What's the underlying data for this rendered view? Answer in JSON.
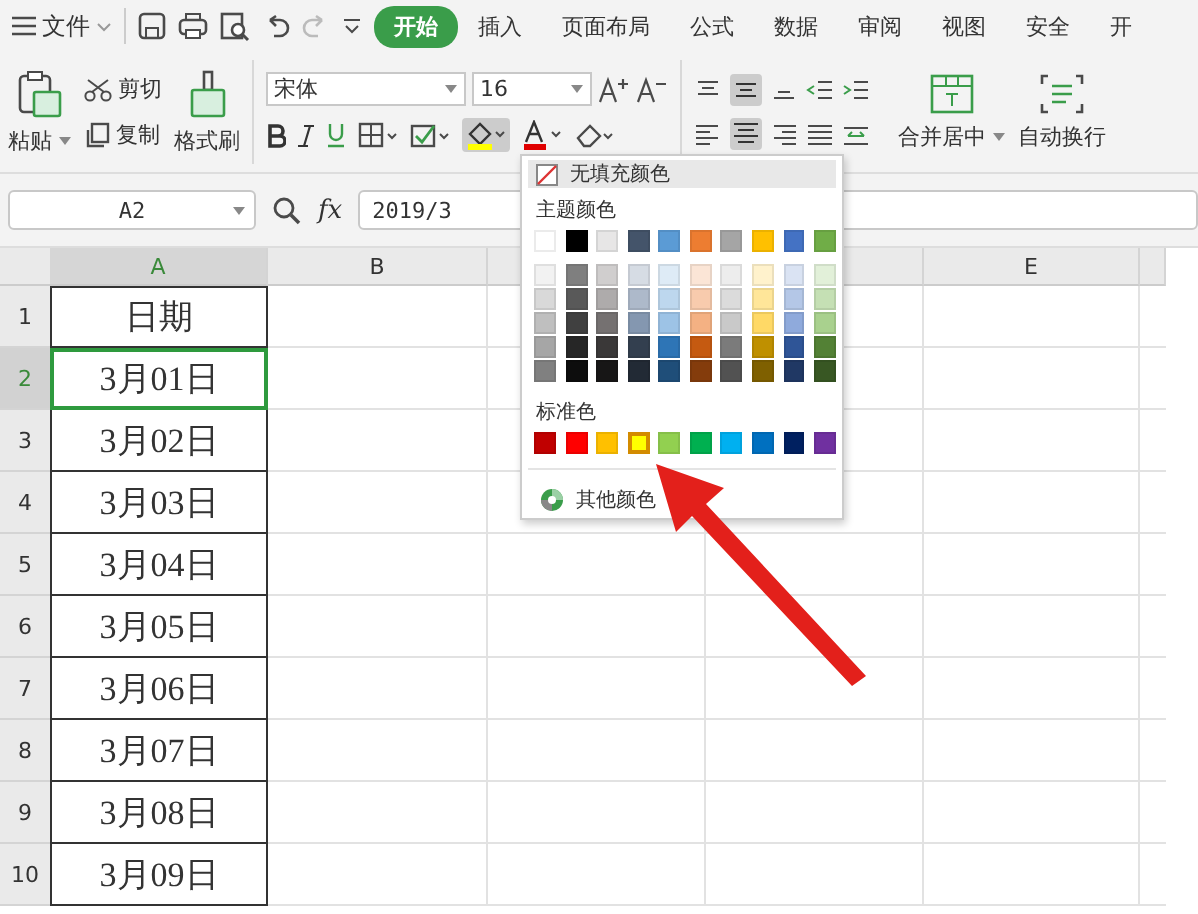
{
  "menu_bar": {
    "file_menu": "文件",
    "tabs": [
      {
        "label": "开始",
        "selected": true
      },
      {
        "label": "插入",
        "selected": false
      },
      {
        "label": "页面布局",
        "selected": false
      },
      {
        "label": "公式",
        "selected": false
      },
      {
        "label": "数据",
        "selected": false
      },
      {
        "label": "审阅",
        "selected": false
      },
      {
        "label": "视图",
        "selected": false
      },
      {
        "label": "安全",
        "selected": false
      },
      {
        "label": "开",
        "selected": false
      }
    ]
  },
  "ribbon": {
    "paste": "粘贴",
    "cut": "剪切",
    "copy": "复制",
    "format_painter": "格式刷",
    "font": "宋体",
    "font_size": "16",
    "merge_center": "合并居中",
    "wrap_text": "自动换行"
  },
  "formula_bar": {
    "name_box": "A2",
    "fx": "fx",
    "formula": "2019/3"
  },
  "sheet": {
    "columns": [
      {
        "label": "A",
        "selected": true
      },
      {
        "label": "B",
        "selected": false
      },
      {
        "label": "E",
        "selected": false
      }
    ],
    "rows": [
      {
        "number": "1",
        "selected": false,
        "value": "日期"
      },
      {
        "number": "2",
        "selected": true,
        "value": "3月01日"
      },
      {
        "number": "3",
        "selected": false,
        "value": "3月02日"
      },
      {
        "number": "4",
        "selected": false,
        "value": "3月03日"
      },
      {
        "number": "5",
        "selected": false,
        "value": "3月04日"
      },
      {
        "number": "6",
        "selected": false,
        "value": "3月05日"
      },
      {
        "number": "7",
        "selected": false,
        "value": "3月06日"
      },
      {
        "number": "8",
        "selected": false,
        "value": "3月07日"
      },
      {
        "number": "9",
        "selected": false,
        "value": "3月08日"
      },
      {
        "number": "10",
        "selected": false,
        "value": "3月09日"
      }
    ]
  },
  "palette": {
    "no_fill": "无填充颜色",
    "theme_label": "主题颜色",
    "theme": [
      {
        "color": "#ffffff"
      },
      {
        "color": "#000000"
      },
      {
        "color": "#e7e6e6"
      },
      {
        "color": "#44546a"
      },
      {
        "color": "#5b9bd5"
      },
      {
        "color": "#ed7d31"
      },
      {
        "color": "#a5a5a5"
      },
      {
        "color": "#ffc000"
      },
      {
        "color": "#4472c4"
      },
      {
        "color": "#70ad47"
      }
    ],
    "shade_rows": [
      {
        "swatches": [
          {
            "color": "#f2f2f2"
          },
          {
            "color": "#7f7f7f"
          },
          {
            "color": "#d0cece"
          },
          {
            "color": "#d6dce4"
          },
          {
            "color": "#deebf6"
          },
          {
            "color": "#fbe5d6"
          },
          {
            "color": "#ededed"
          },
          {
            "color": "#fff2cc"
          },
          {
            "color": "#dae3f3"
          },
          {
            "color": "#e2f0d9"
          }
        ]
      },
      {
        "swatches": [
          {
            "color": "#d9d9d9"
          },
          {
            "color": "#595959"
          },
          {
            "color": "#aeabab"
          },
          {
            "color": "#adb9ca"
          },
          {
            "color": "#bdd7ee"
          },
          {
            "color": "#f8cbad"
          },
          {
            "color": "#dbdbdb"
          },
          {
            "color": "#ffe699"
          },
          {
            "color": "#b4c7e7"
          },
          {
            "color": "#c5e0b4"
          }
        ]
      },
      {
        "swatches": [
          {
            "color": "#bfbfbf"
          },
          {
            "color": "#404040"
          },
          {
            "color": "#757171"
          },
          {
            "color": "#8497b0"
          },
          {
            "color": "#9dc3e6"
          },
          {
            "color": "#f4b183"
          },
          {
            "color": "#c9c9c9"
          },
          {
            "color": "#ffd966"
          },
          {
            "color": "#8faadc"
          },
          {
            "color": "#a9d18e"
          }
        ]
      },
      {
        "swatches": [
          {
            "color": "#a6a6a6"
          },
          {
            "color": "#262626"
          },
          {
            "color": "#3a3838"
          },
          {
            "color": "#333f4f"
          },
          {
            "color": "#2e75b6"
          },
          {
            "color": "#c55a11"
          },
          {
            "color": "#7b7b7b"
          },
          {
            "color": "#bf9000"
          },
          {
            "color": "#2f5597"
          },
          {
            "color": "#538135"
          }
        ]
      },
      {
        "swatches": [
          {
            "color": "#808080"
          },
          {
            "color": "#0d0d0d"
          },
          {
            "color": "#171616"
          },
          {
            "color": "#222a35"
          },
          {
            "color": "#1f4e79"
          },
          {
            "color": "#843c0c"
          },
          {
            "color": "#525252"
          },
          {
            "color": "#7f6000"
          },
          {
            "color": "#203864"
          },
          {
            "color": "#385723"
          }
        ]
      }
    ],
    "standard_label": "标准色",
    "standard": [
      {
        "color": "#c00000",
        "selected": false
      },
      {
        "color": "#ff0000",
        "selected": false
      },
      {
        "color": "#ffc000",
        "selected": false
      },
      {
        "color": "#ffff00",
        "selected": true
      },
      {
        "color": "#92d050",
        "selected": false
      },
      {
        "color": "#00b050",
        "selected": false
      },
      {
        "color": "#00b0f0",
        "selected": false
      },
      {
        "color": "#0070c0",
        "selected": false
      },
      {
        "color": "#002060",
        "selected": false
      },
      {
        "color": "#7030a0",
        "selected": false
      }
    ],
    "more_colors": "其他颜色"
  }
}
